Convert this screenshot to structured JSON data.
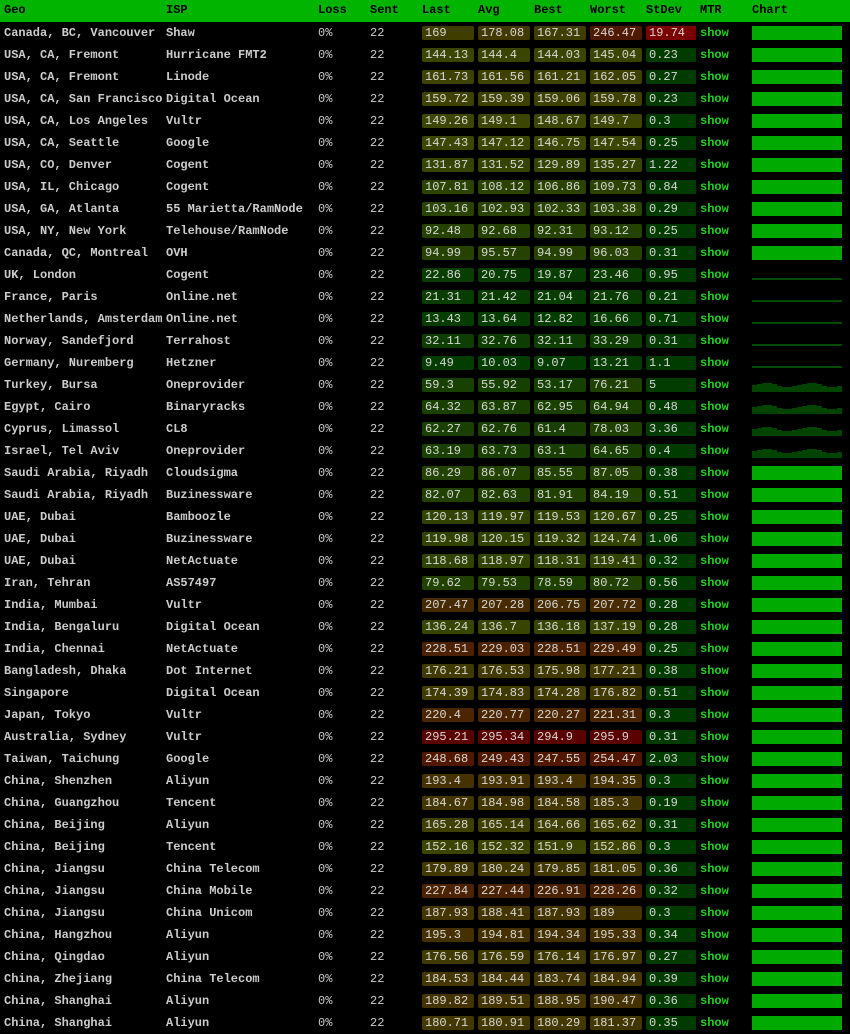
{
  "headers": {
    "geo": "Geo",
    "isp": "ISP",
    "loss": "Loss",
    "sent": "Sent",
    "last": "Last",
    "avg": "Avg",
    "best": "Best",
    "worst": "Worst",
    "stdev": "StDev",
    "mtr": "MTR",
    "chart": "Chart"
  },
  "mtr_label": "show",
  "latency_color_scale": {
    "min_ms": 0,
    "mid_ms": 120,
    "max_ms": 300,
    "low_color": "#003c00",
    "mid_color": "#1a4a00",
    "high_color": "#4a0000"
  },
  "rows": [
    {
      "geo": "Canada, BC, Vancouver",
      "isp": "Shaw",
      "loss": "0%",
      "sent": "22",
      "last": "169",
      "avg": "178.08",
      "best": "167.31",
      "worst": "246.47",
      "stdev": "19.74",
      "stdev_hot": true,
      "chart": "full"
    },
    {
      "geo": "USA, CA, Fremont",
      "isp": "Hurricane FMT2",
      "loss": "0%",
      "sent": "22",
      "last": "144.13",
      "avg": "144.4",
      "best": "144.03",
      "worst": "145.04",
      "stdev": "0.23",
      "chart": "full"
    },
    {
      "geo": "USA, CA, Fremont",
      "isp": "Linode",
      "loss": "0%",
      "sent": "22",
      "last": "161.73",
      "avg": "161.56",
      "best": "161.21",
      "worst": "162.05",
      "stdev": "0.27",
      "chart": "full"
    },
    {
      "geo": "USA, CA, San Francisco",
      "isp": "Digital Ocean",
      "loss": "0%",
      "sent": "22",
      "last": "159.72",
      "avg": "159.39",
      "best": "159.06",
      "worst": "159.78",
      "stdev": "0.23",
      "chart": "full"
    },
    {
      "geo": "USA, CA, Los Angeles",
      "isp": "Vultr",
      "loss": "0%",
      "sent": "22",
      "last": "149.26",
      "avg": "149.1",
      "best": "148.67",
      "worst": "149.7",
      "stdev": "0.3",
      "chart": "full"
    },
    {
      "geo": "USA, CA, Seattle",
      "isp": "Google",
      "loss": "0%",
      "sent": "22",
      "last": "147.43",
      "avg": "147.12",
      "best": "146.75",
      "worst": "147.54",
      "stdev": "0.25",
      "chart": "full"
    },
    {
      "geo": "USA, CO, Denver",
      "isp": "Cogent",
      "loss": "0%",
      "sent": "22",
      "last": "131.87",
      "avg": "131.52",
      "best": "129.89",
      "worst": "135.27",
      "stdev": "1.22",
      "chart": "full"
    },
    {
      "geo": "USA, IL, Chicago",
      "isp": "Cogent",
      "loss": "0%",
      "sent": "22",
      "last": "107.81",
      "avg": "108.12",
      "best": "106.86",
      "worst": "109.73",
      "stdev": "0.84",
      "chart": "full"
    },
    {
      "geo": "USA, GA, Atlanta",
      "isp": "55 Marietta/RamNode",
      "loss": "0%",
      "sent": "22",
      "last": "103.16",
      "avg": "102.93",
      "best": "102.33",
      "worst": "103.38",
      "stdev": "0.29",
      "chart": "full"
    },
    {
      "geo": "USA, NY, New York",
      "isp": "Telehouse/RamNode",
      "loss": "0%",
      "sent": "22",
      "last": "92.48",
      "avg": "92.68",
      "best": "92.31",
      "worst": "93.12",
      "stdev": "0.25",
      "chart": "full"
    },
    {
      "geo": "Canada, QC, Montreal",
      "isp": "OVH",
      "loss": "0%",
      "sent": "22",
      "last": "94.99",
      "avg": "95.57",
      "best": "94.99",
      "worst": "96.03",
      "stdev": "0.31",
      "chart": "full"
    },
    {
      "geo": "UK, London",
      "isp": "Cogent",
      "loss": "0%",
      "sent": "22",
      "last": "22.86",
      "avg": "20.75",
      "best": "19.87",
      "worst": "23.46",
      "stdev": "0.95",
      "chart": "dashed"
    },
    {
      "geo": "France, Paris",
      "isp": "Online.net",
      "loss": "0%",
      "sent": "22",
      "last": "21.31",
      "avg": "21.42",
      "best": "21.04",
      "worst": "21.76",
      "stdev": "0.21",
      "chart": "dashed"
    },
    {
      "geo": "Netherlands, Amsterdam",
      "isp": "Online.net",
      "loss": "0%",
      "sent": "22",
      "last": "13.43",
      "avg": "13.64",
      "best": "12.82",
      "worst": "16.66",
      "stdev": "0.71",
      "chart": "dashed"
    },
    {
      "geo": "Norway, Sandefjord",
      "isp": "Terrahost",
      "loss": "0%",
      "sent": "22",
      "last": "32.11",
      "avg": "32.76",
      "best": "32.11",
      "worst": "33.29",
      "stdev": "0.31",
      "chart": "dashed"
    },
    {
      "geo": "Germany, Nuremberg",
      "isp": "Hetzner",
      "loss": "0%",
      "sent": "22",
      "last": "9.49",
      "avg": "10.03",
      "best": "9.07",
      "worst": "13.21",
      "stdev": "1.1",
      "chart": "dashed"
    },
    {
      "geo": "Turkey, Bursa",
      "isp": "Oneprovider",
      "loss": "0%",
      "sent": "22",
      "last": "59.3",
      "avg": "55.92",
      "best": "53.17",
      "worst": "76.21",
      "stdev": "5",
      "chart": "dim"
    },
    {
      "geo": "Egypt, Cairo",
      "isp": "Binaryracks",
      "loss": "0%",
      "sent": "22",
      "last": "64.32",
      "avg": "63.87",
      "best": "62.95",
      "worst": "64.94",
      "stdev": "0.48",
      "chart": "dim"
    },
    {
      "geo": "Cyprus, Limassol",
      "isp": "CL8",
      "loss": "0%",
      "sent": "22",
      "last": "62.27",
      "avg": "62.76",
      "best": "61.4",
      "worst": "78.03",
      "stdev": "3.36",
      "chart": "dim"
    },
    {
      "geo": "Israel, Tel Aviv",
      "isp": "Oneprovider",
      "loss": "0%",
      "sent": "22",
      "last": "63.19",
      "avg": "63.73",
      "best": "63.1",
      "worst": "64.65",
      "stdev": "0.4",
      "chart": "dim"
    },
    {
      "geo": "Saudi Arabia, Riyadh",
      "isp": "Cloudsigma",
      "loss": "0%",
      "sent": "22",
      "last": "86.29",
      "avg": "86.07",
      "best": "85.55",
      "worst": "87.05",
      "stdev": "0.38",
      "chart": "full"
    },
    {
      "geo": "Saudi Arabia, Riyadh",
      "isp": "Buzinessware",
      "loss": "0%",
      "sent": "22",
      "last": "82.07",
      "avg": "82.63",
      "best": "81.91",
      "worst": "84.19",
      "stdev": "0.51",
      "chart": "full"
    },
    {
      "geo": "UAE, Dubai",
      "isp": "Bamboozle",
      "loss": "0%",
      "sent": "22",
      "last": "120.13",
      "avg": "119.97",
      "best": "119.53",
      "worst": "120.67",
      "stdev": "0.25",
      "chart": "full"
    },
    {
      "geo": "UAE, Dubai",
      "isp": "Buzinessware",
      "loss": "0%",
      "sent": "22",
      "last": "119.98",
      "avg": "120.15",
      "best": "119.32",
      "worst": "124.74",
      "stdev": "1.06",
      "chart": "full"
    },
    {
      "geo": "UAE, Dubai",
      "isp": "NetActuate",
      "loss": "0%",
      "sent": "22",
      "last": "118.68",
      "avg": "118.97",
      "best": "118.31",
      "worst": "119.41",
      "stdev": "0.32",
      "chart": "full"
    },
    {
      "geo": "Iran, Tehran",
      "isp": "AS57497",
      "loss": "0%",
      "sent": "22",
      "last": "79.62",
      "avg": "79.53",
      "best": "78.59",
      "worst": "80.72",
      "stdev": "0.56",
      "chart": "full"
    },
    {
      "geo": "India, Mumbai",
      "isp": "Vultr",
      "loss": "0%",
      "sent": "22",
      "last": "207.47",
      "avg": "207.28",
      "best": "206.75",
      "worst": "207.72",
      "stdev": "0.28",
      "chart": "full"
    },
    {
      "geo": "India, Bengaluru",
      "isp": "Digital Ocean",
      "loss": "0%",
      "sent": "22",
      "last": "136.24",
      "avg": "136.7",
      "best": "136.18",
      "worst": "137.19",
      "stdev": "0.28",
      "chart": "full"
    },
    {
      "geo": "India, Chennai",
      "isp": "NetActuate",
      "loss": "0%",
      "sent": "22",
      "last": "228.51",
      "avg": "229.03",
      "best": "228.51",
      "worst": "229.49",
      "stdev": "0.25",
      "chart": "full"
    },
    {
      "geo": "Bangladesh, Dhaka",
      "isp": "Dot Internet",
      "loss": "0%",
      "sent": "22",
      "last": "176.21",
      "avg": "176.53",
      "best": "175.98",
      "worst": "177.21",
      "stdev": "0.38",
      "chart": "full"
    },
    {
      "geo": "Singapore",
      "isp": "Digital Ocean",
      "loss": "0%",
      "sent": "22",
      "last": "174.39",
      "avg": "174.83",
      "best": "174.28",
      "worst": "176.82",
      "stdev": "0.51",
      "chart": "full"
    },
    {
      "geo": "Japan, Tokyo",
      "isp": "Vultr",
      "loss": "0%",
      "sent": "22",
      "last": "220.4",
      "avg": "220.77",
      "best": "220.27",
      "worst": "221.31",
      "stdev": "0.3",
      "chart": "full"
    },
    {
      "geo": "Australia, Sydney",
      "isp": "Vultr",
      "loss": "0%",
      "sent": "22",
      "last": "295.21",
      "avg": "295.34",
      "best": "294.9",
      "worst": "295.9",
      "stdev": "0.31",
      "chart": "full"
    },
    {
      "geo": "Taiwan, Taichung",
      "isp": "Google",
      "loss": "0%",
      "sent": "22",
      "last": "248.68",
      "avg": "249.43",
      "best": "247.55",
      "worst": "254.47",
      "stdev": "2.03",
      "chart": "full"
    },
    {
      "geo": "China, Shenzhen",
      "isp": "Aliyun",
      "loss": "0%",
      "sent": "22",
      "last": "193.4",
      "avg": "193.91",
      "best": "193.4",
      "worst": "194.35",
      "stdev": "0.3",
      "chart": "full"
    },
    {
      "geo": "China, Guangzhou",
      "isp": "Tencent",
      "loss": "0%",
      "sent": "22",
      "last": "184.67",
      "avg": "184.98",
      "best": "184.58",
      "worst": "185.3",
      "stdev": "0.19",
      "chart": "full"
    },
    {
      "geo": "China, Beijing",
      "isp": "Aliyun",
      "loss": "0%",
      "sent": "22",
      "last": "165.28",
      "avg": "165.14",
      "best": "164.66",
      "worst": "165.62",
      "stdev": "0.31",
      "chart": "full"
    },
    {
      "geo": "China, Beijing",
      "isp": "Tencent",
      "loss": "0%",
      "sent": "22",
      "last": "152.16",
      "avg": "152.32",
      "best": "151.9",
      "worst": "152.86",
      "stdev": "0.3",
      "chart": "full"
    },
    {
      "geo": "China, Jiangsu",
      "isp": "China Telecom",
      "loss": "0%",
      "sent": "22",
      "last": "179.89",
      "avg": "180.24",
      "best": "179.85",
      "worst": "181.05",
      "stdev": "0.36",
      "chart": "full"
    },
    {
      "geo": "China, Jiangsu",
      "isp": "China Mobile",
      "loss": "0%",
      "sent": "22",
      "last": "227.84",
      "avg": "227.44",
      "best": "226.91",
      "worst": "228.26",
      "stdev": "0.32",
      "chart": "full"
    },
    {
      "geo": "China, Jiangsu",
      "isp": "China Unicom",
      "loss": "0%",
      "sent": "22",
      "last": "187.93",
      "avg": "188.41",
      "best": "187.93",
      "worst": "189",
      "stdev": "0.3",
      "chart": "full"
    },
    {
      "geo": "China, Hangzhou",
      "isp": "Aliyun",
      "loss": "0%",
      "sent": "22",
      "last": "195.3",
      "avg": "194.81",
      "best": "194.34",
      "worst": "195.33",
      "stdev": "0.34",
      "chart": "full"
    },
    {
      "geo": "China, Qingdao",
      "isp": "Aliyun",
      "loss": "0%",
      "sent": "22",
      "last": "176.56",
      "avg": "176.59",
      "best": "176.14",
      "worst": "176.97",
      "stdev": "0.27",
      "chart": "full"
    },
    {
      "geo": "China, Zhejiang",
      "isp": "China Telecom",
      "loss": "0%",
      "sent": "22",
      "last": "184.53",
      "avg": "184.44",
      "best": "183.74",
      "worst": "184.94",
      "stdev": "0.39",
      "chart": "full"
    },
    {
      "geo": "China, Shanghai",
      "isp": "Aliyun",
      "loss": "0%",
      "sent": "22",
      "last": "189.82",
      "avg": "189.51",
      "best": "188.95",
      "worst": "190.47",
      "stdev": "0.36",
      "chart": "full"
    },
    {
      "geo": "China, Shanghai",
      "isp": "Aliyun",
      "loss": "0%",
      "sent": "22",
      "last": "180.71",
      "avg": "180.91",
      "best": "180.29",
      "worst": "181.37",
      "stdev": "0.35",
      "chart": "full"
    }
  ]
}
